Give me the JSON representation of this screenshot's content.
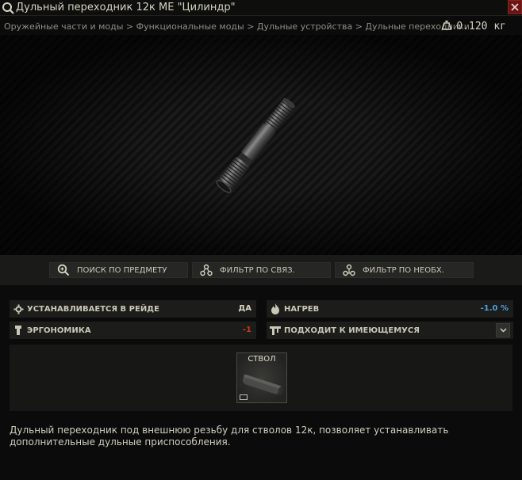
{
  "window": {
    "title": "Дульный переходник 12к МЕ \"Цилиндр\""
  },
  "breadcrumb": "Оружейные части и моды > Функциональные моды > Дульные устройства > Дульные переходники",
  "weight": "0.120 кг",
  "actions": {
    "search": "ПОИСК ПО ПРЕДМЕТУ",
    "linked_filter": "ФИЛЬТР ПО СВЯЗ.",
    "required_filter": "ФИЛЬТР ПО НЕОБХ."
  },
  "stats": {
    "raid_install": {
      "label": "УСТАНАВЛИВАЕТСЯ В РЕЙДЕ",
      "value": "ДА"
    },
    "heat": {
      "label": "НАГРЕВ",
      "value": "-1.0 %"
    },
    "ergonomics": {
      "label": "ЭРГОНОМИКА",
      "value": "-1"
    },
    "compatible": {
      "label": "ПОДХОДИТ К ИМЕЮЩЕМУСЯ"
    }
  },
  "slot": {
    "label": "СТВОЛ"
  },
  "description": "Дульный переходник под внешнюю резьбу для стволов 12к, позволяет устанавливать дополнительные дульные приспособления.",
  "colors": {
    "heat_value": "#4aa3df",
    "ergonomics_value": "#c0392b",
    "close_button": "#6a1414"
  }
}
